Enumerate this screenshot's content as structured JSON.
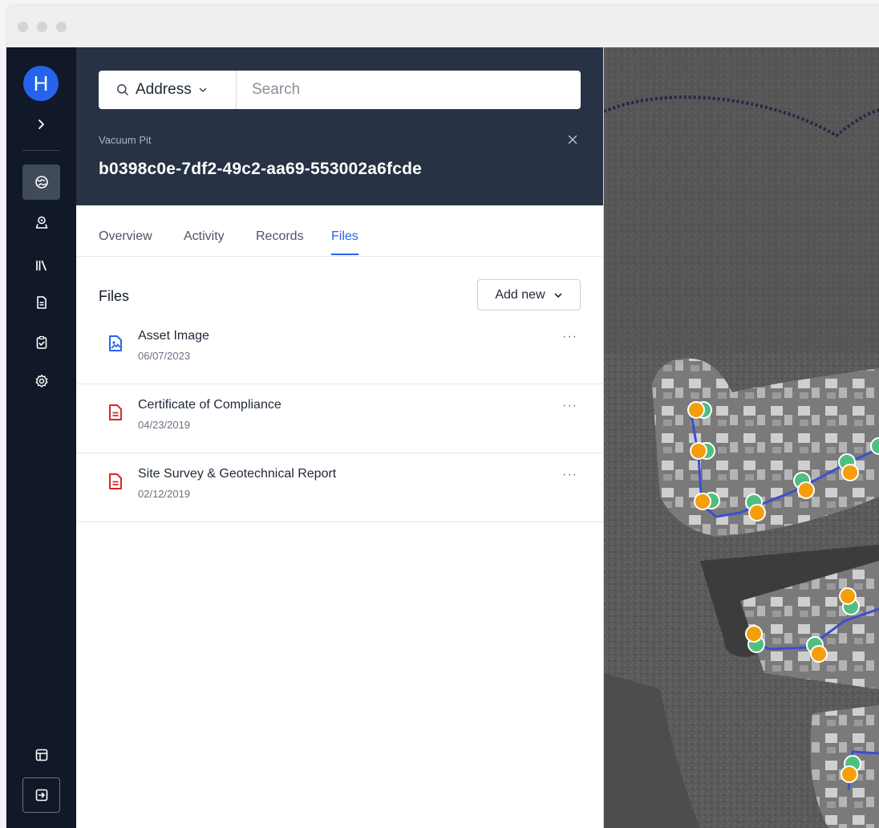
{
  "window": {
    "controls": [
      "close",
      "minimize",
      "maximize"
    ]
  },
  "rail": {
    "avatar_initial": "H",
    "nav": [
      {
        "name": "map",
        "icon": "map-icon",
        "active": true
      },
      {
        "name": "locations",
        "icon": "location-user-icon",
        "active": false
      },
      {
        "name": "library",
        "icon": "library-icon",
        "active": false
      },
      {
        "name": "documents",
        "icon": "document-icon",
        "active": false
      },
      {
        "name": "tasks",
        "icon": "clipboard-check-icon",
        "active": false
      },
      {
        "name": "settings",
        "icon": "gear-icon",
        "active": false
      }
    ],
    "bottom": [
      {
        "name": "layout",
        "icon": "layout-icon"
      },
      {
        "name": "sign-out",
        "icon": "sign-out-icon"
      }
    ]
  },
  "search": {
    "type_label": "Address",
    "placeholder": "Search",
    "value": ""
  },
  "asset": {
    "type": "Vacuum Pit",
    "id": "b0398c0e-7df2-49c2-aa69-553002a6fcde"
  },
  "tabs": [
    {
      "label": "Overview",
      "active": false
    },
    {
      "label": "Activity",
      "active": false
    },
    {
      "label": "Records",
      "active": false
    },
    {
      "label": "Files",
      "active": true
    }
  ],
  "files": {
    "title": "Files",
    "add_new_label": "Add new",
    "items": [
      {
        "name": "Asset Image",
        "date": "06/07/2023",
        "kind": "image",
        "icon": "image-file-icon",
        "color": "#2563eb"
      },
      {
        "name": "Certificate of Compliance",
        "date": "04/23/2019",
        "kind": "document",
        "icon": "document-file-icon",
        "color": "#dc2626"
      },
      {
        "name": "Site Survey & Geotechnical Report",
        "date": "02/12/2019",
        "kind": "document",
        "icon": "document-file-icon",
        "color": "#dc2626"
      }
    ],
    "more_label": "···"
  },
  "map": {
    "colors": {
      "pipe": "#3b4fd0",
      "marker_primary": "#f59e0b",
      "marker_secondary": "#4fbf80",
      "boundary": "#1e2a44"
    }
  }
}
